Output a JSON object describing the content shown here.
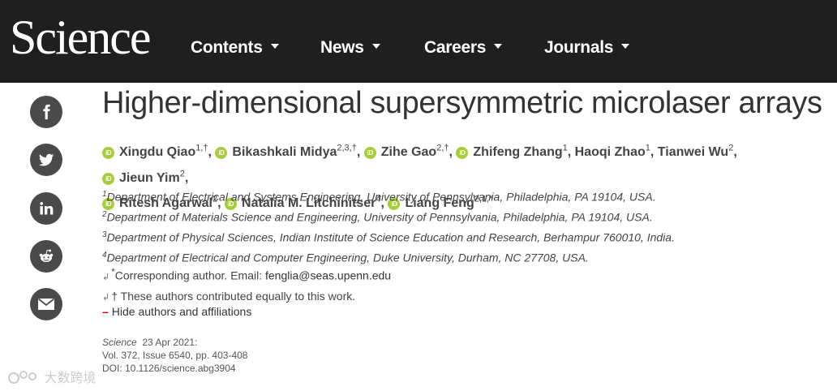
{
  "header": {
    "logo": "Science",
    "nav": [
      {
        "label": "Contents"
      },
      {
        "label": "News"
      },
      {
        "label": "Careers"
      },
      {
        "label": "Journals"
      }
    ]
  },
  "share": [
    "facebook-icon",
    "twitter-icon",
    "linkedin-icon",
    "reddit-icon",
    "email-icon"
  ],
  "article": {
    "title": "Higher-dimensional supersymmetric microlaser arrays",
    "authors": [
      {
        "name": "Xingdu Qiao",
        "sup": "1,†",
        "orcid": true,
        "sep": ","
      },
      {
        "name": "Bikashkali Midya",
        "sup": "2,3,†",
        "orcid": true,
        "sep": ","
      },
      {
        "name": "Zihe Gao",
        "sup": "2,†",
        "orcid": true,
        "sep": ","
      },
      {
        "name": "Zhifeng Zhang",
        "sup": "1",
        "orcid": true,
        "sep": ","
      },
      {
        "name": "Haoqi Zhao",
        "sup": "1",
        "orcid": false,
        "sep": ","
      },
      {
        "name": "Tianwei Wu",
        "sup": "2",
        "orcid": false,
        "sep": ","
      },
      {
        "name": "Jieun Yim",
        "sup": "2",
        "orcid": true,
        "sep": ","
      },
      {
        "name": "Ritesh Agarwal",
        "sup": "2",
        "orcid": true,
        "sep": ","
      },
      {
        "name": "Natalia M. Litchinitser",
        "sup": "4",
        "orcid": true,
        "sep": ","
      },
      {
        "name": "Liang Feng",
        "sup": "2,1,*",
        "orcid": true,
        "sep": ""
      }
    ],
    "orcid_label": "iD",
    "affiliations": [
      {
        "num": "1",
        "text": "Department of Electrical and Systems Engineering, University of Pennsylvania, Philadelphia, PA 19104, USA."
      },
      {
        "num": "2",
        "text": "Department of Materials Science and Engineering, University of Pennsylvania, Philadelphia, PA 19104, USA."
      },
      {
        "num": "3",
        "text": "Department of Physical Sciences, Indian Institute of Science Education and Research, Berhampur 760010, India."
      },
      {
        "num": "4",
        "text": "Department of Electrical and Computer Engineering, Duke University, Durham, NC 27708, USA."
      }
    ],
    "corresponding": {
      "mark": "*",
      "text": "Corresponding author. Email: ",
      "email": "fenglia@seas.upenn.edu"
    },
    "equal": "† These authors contributed equally to this work.",
    "return_glyph": "↲",
    "hide_label": "Hide authors and affiliations",
    "hide_glyph": "–",
    "citation": {
      "journal": "Science",
      "date": "23 Apr 2021:",
      "volume": "Vol. 372, Issue 6540, pp. 403-408",
      "doi": "DOI: 10.1126/science.abg3904"
    }
  },
  "watermark": "大数跨境"
}
